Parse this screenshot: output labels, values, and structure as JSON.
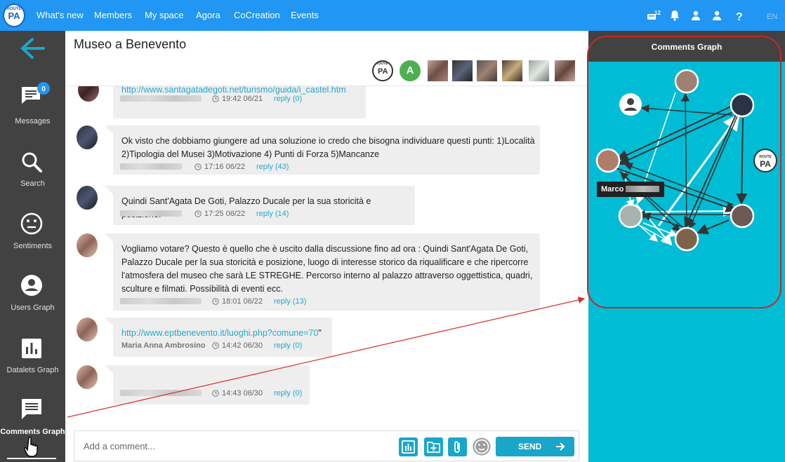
{
  "app": {
    "logo_top": "ROUTE",
    "logo_bottom": "PA"
  },
  "nav": {
    "items": [
      "What's new",
      "Members",
      "My space",
      "Agora",
      "CoCreation",
      "Events"
    ],
    "notif_count": "12",
    "lang": "EN"
  },
  "sidebar": {
    "messages_badge": "0",
    "items": [
      "Messages",
      "Search",
      "Sentiments",
      "Users Graph",
      "Datalets Graph",
      "Comments Graph"
    ]
  },
  "room": {
    "title": "Museo a Benevento",
    "participant_initial": "A",
    "accent": "#1aa6c9"
  },
  "messages": [
    {
      "text": "http://www.santagatadegoti.net/turismo/guida/i_castel.htm",
      "time": "19:42 06/21",
      "reply": "reply (0)"
    },
    {
      "text": "Ok visto che dobbiamo giungere ad una soluzione io credo che bisogna individuare questi punti: 1)Località 2)Tipologia del Musei 3)Motivazione 4) Punti di Forza 5)Mancanze",
      "time": "17:16 06/22",
      "reply": "reply (43)"
    },
    {
      "text": "Quindi Sant'Agata De Goti, Palazzo Ducale per la sua storicità e posizione.",
      "time": "17:25 06/22",
      "reply": "reply (14)"
    },
    {
      "text": "Vogliamo votare? Questo è quello che è uscito dalla discussione fino ad ora : Quindi Sant'Agata De Goti, Palazzo Ducale per la sua storicità e posizione, luogo di interesse storico da riqualificare e che ripercorre l'atmosfera del museo che sarà LE STREGHE. Percorso interno al palazzo attraverso oggettistica, quadri, sculture e filmati. Possibilità di eventi ecc.",
      "time": "18:01 06/22",
      "reply": "reply (13)"
    },
    {
      "text": "http://www.eptbenevento.it/luoghi.php?comune=70",
      "text_suffix": "\"",
      "author": "Maria Anna Ambrosino",
      "time": "14:42 06/30",
      "reply": "reply (0)"
    },
    {
      "text": "",
      "time": "14:43 06/30",
      "reply": "reply (0)"
    }
  ],
  "composer": {
    "placeholder": "Add a comment...",
    "send_label": "SEND"
  },
  "panel": {
    "title": "Comments Graph",
    "tooltip_name": "Marco"
  }
}
